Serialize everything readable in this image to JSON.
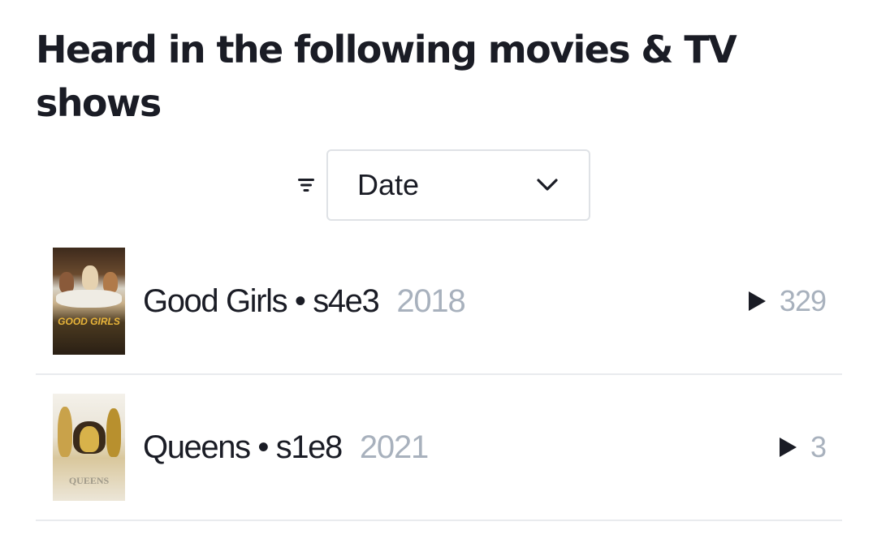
{
  "section": {
    "heading": "Heard in the following movies & TV shows"
  },
  "sort": {
    "icon": "filter-icon",
    "selected": "Date",
    "chevron": "chevron-down-icon"
  },
  "items": [
    {
      "title": "Good Girls • s4e3",
      "year": "2018",
      "play_icon": "play-icon",
      "plays": "329",
      "poster_text": "GOOD GIRLS"
    },
    {
      "title": "Queens • s1e8",
      "year": "2021",
      "play_icon": "play-icon",
      "plays": "3",
      "poster_text": "QUEENS"
    }
  ]
}
